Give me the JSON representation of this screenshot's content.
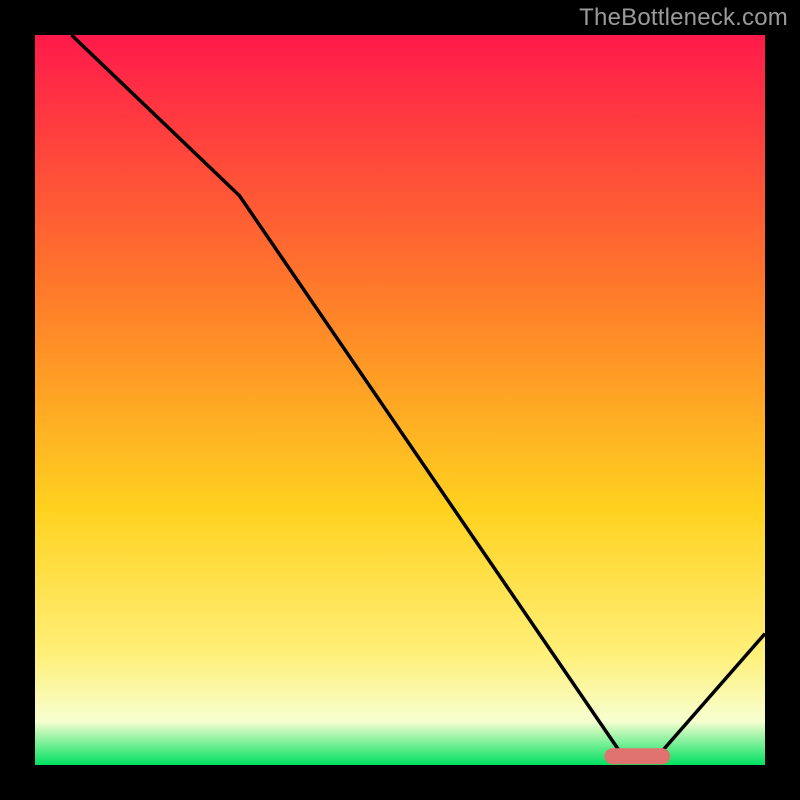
{
  "watermark": "TheBottleneck.com",
  "chart_data": {
    "type": "line",
    "title": "",
    "xlabel": "",
    "ylabel": "",
    "xlim": [
      0,
      100
    ],
    "ylim": [
      0,
      100
    ],
    "grid": false,
    "legend": false,
    "gradient_colors": {
      "top": "#ff1a4b",
      "mid1": "#ff7a2a",
      "mid2": "#ffd21f",
      "mid3": "#fff07a",
      "mid4": "#f7ffd0",
      "bottom": "#00e060"
    },
    "series": [
      {
        "name": "bottleneck-curve",
        "color": "#000000",
        "x": [
          5,
          28,
          80,
          86,
          100
        ],
        "y": [
          100,
          78,
          2,
          2,
          18
        ]
      }
    ],
    "marker": {
      "name": "optimal-range",
      "color": "#e0736f",
      "x_start": 78,
      "x_end": 87,
      "y": 1.2,
      "thickness": 2.2
    }
  }
}
